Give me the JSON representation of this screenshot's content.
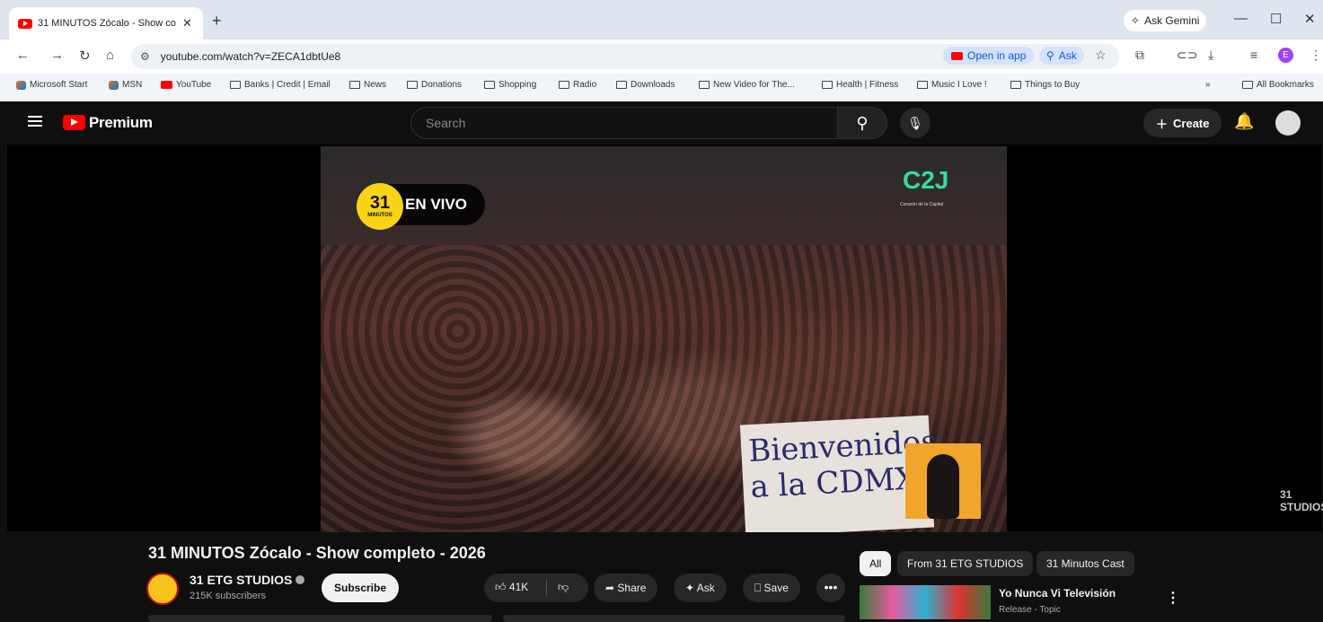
{
  "browser": {
    "tab_title": "31 MINUTOS Zócalo - Show co",
    "tab_close": "✕",
    "new_tab": "+",
    "gemini_label": "Ask Gemini",
    "window_controls": [
      "—",
      "☐",
      "✕"
    ],
    "url": "youtube.com/watch?v=ZECA1dbtUe8",
    "open_in_app": "Open in app",
    "ask_label": "Ask",
    "profile_initial": "E",
    "bookmarks": [
      "Microsoft Start",
      "MSN",
      "YouTube",
      "Banks | Credit | Email",
      "News",
      "Donations",
      "Shopping",
      "Radio",
      "Downloads",
      "New Video for The...",
      "Health | Fitness",
      "Music I Love !",
      "Things to Buy"
    ],
    "bookmarks_overflow": "»",
    "all_bookmarks": "All Bookmarks"
  },
  "youtube": {
    "brand": "Premium",
    "search_placeholder": "Search",
    "create_label": "Create",
    "video_overlay": {
      "badge": "31",
      "badge_sub": "MINUTOS",
      "live_label": "EN VIVO",
      "channel_bug": "C2J",
      "channel_bug_sub": "Corazón de la Capital",
      "sign_line1": "Bienvenidos",
      "sign_line2": "a la CDMX",
      "watermark": "31 STUDIOS"
    },
    "video_title": "31 MINUTOS Zócalo - Show completo - 2026",
    "channel_name": "31 ETG STUDIOS",
    "subscribers": "215K subscribers",
    "subscribe_label": "Subscribe",
    "like_count": "41K",
    "share_label": "Share",
    "ask_label": "Ask",
    "save_label": "Save",
    "chips": [
      "All",
      "From 31 ETG STUDIOS",
      "31 Minutos Cast"
    ],
    "recommended": {
      "title": "Yo Nunca Vi Televisión",
      "subtitle": "Release - Topic"
    }
  },
  "colors": {
    "accent_red": "#ff0000",
    "page_bg": "#0f0f0f",
    "chip_active": "#f1f1f1"
  }
}
